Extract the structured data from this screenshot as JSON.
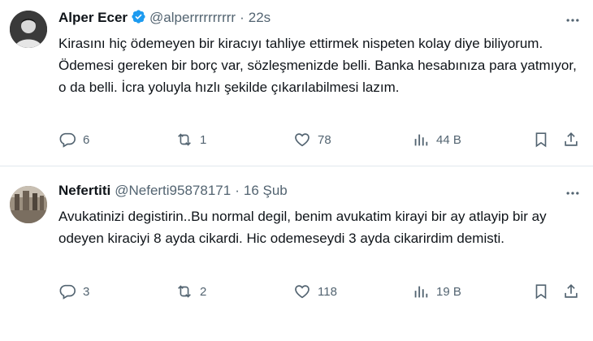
{
  "tweets": [
    {
      "name": "Alper Ecer",
      "handle": "@alperrrrrrrrrr",
      "time": "22s",
      "text": "Kirasını hiç ödemeyen bir kiracıyı tahliye ettirmek nispeten kolay diye biliyorum. Ödemesi gereken bir borç var, sözleşmenizde belli. Banka hesabınıza para yatmıyor, o da belli. İcra yoluyla hızlı şekilde çıkarılabilmesi lazım.",
      "verified": true,
      "replies": "6",
      "retweets": "1",
      "likes": "78",
      "views": "44 B"
    },
    {
      "name": "Nefertiti",
      "handle": "@Neferti95878171",
      "time": "16 Şub",
      "text": "Avukatinizi degistirin..Bu normal degil, benim avukatim kirayi bir ay atlayip bir ay odeyen kiraciyi 8 ayda cikardi. Hic odemeseydi 3 ayda cikarirdim demisti.",
      "verified": false,
      "replies": "3",
      "retweets": "2",
      "likes": "118",
      "views": "19 B"
    }
  ],
  "separator": "·",
  "colors": {
    "text": "#0f1419",
    "secondary": "#536471",
    "verified": "#1d9bf0",
    "divider": "#e1e8ed"
  },
  "icons": [
    "verified-badge-icon",
    "more-icon",
    "reply-icon",
    "retweet-icon",
    "like-icon",
    "views-icon",
    "bookmark-icon",
    "share-icon"
  ]
}
